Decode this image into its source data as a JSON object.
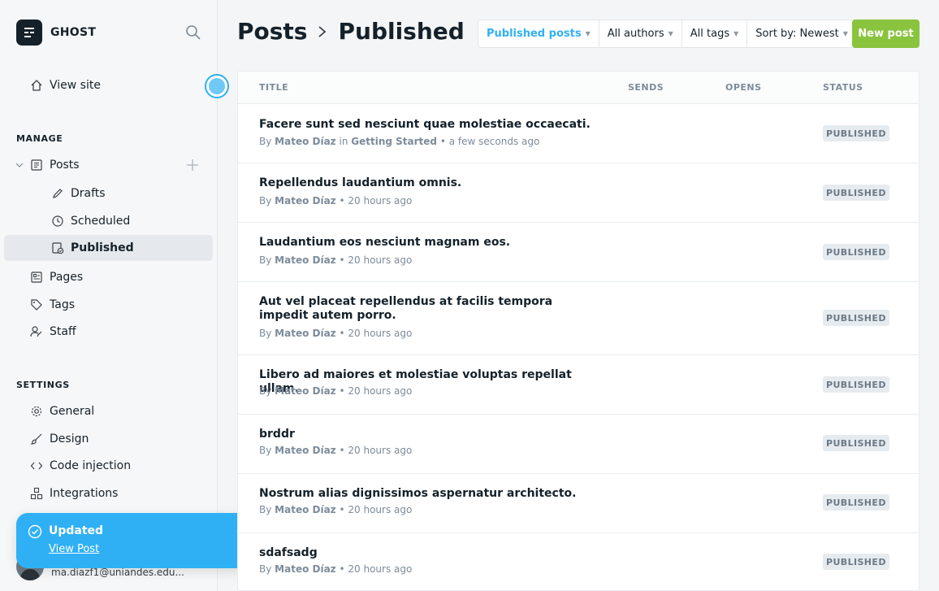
{
  "brand": {
    "name": "GHOST"
  },
  "sidebar": {
    "view_site": "View site",
    "manage_title": "MANAGE",
    "posts": "Posts",
    "drafts": "Drafts",
    "scheduled": "Scheduled",
    "published": "Published",
    "pages": "Pages",
    "tags": "Tags",
    "staff": "Staff",
    "settings_title": "SETTINGS",
    "general": "General",
    "design": "Design",
    "code_injection": "Code injection",
    "integrations": "Integrations"
  },
  "toast": {
    "title": "Updated",
    "link": "View Post"
  },
  "user": {
    "email": "ma.diazf1@uniandes.edu..."
  },
  "header": {
    "title": "Posts",
    "subtitle": "Published",
    "filters": {
      "type": "Published posts",
      "authors": "All authors",
      "tags": "All tags",
      "sort": "Sort by: Newest"
    },
    "new_post": "New post"
  },
  "table": {
    "columns": {
      "title": "TITLE",
      "sends": "SENDS",
      "opens": "OPENS",
      "status": "STATUS"
    },
    "rows": [
      {
        "title": "Facere sunt sed nesciunt quae molestiae occaecati.",
        "by": "By",
        "author": "Mateo Díaz",
        "in": "in",
        "tag": "Getting Started",
        "time": "• a few seconds ago",
        "status": "PUBLISHED"
      },
      {
        "title": "Repellendus laudantium omnis.",
        "by": "By",
        "author": "Mateo Díaz",
        "time": "• 20 hours ago",
        "status": "PUBLISHED"
      },
      {
        "title": "Laudantium eos nesciunt magnam eos.",
        "by": "By",
        "author": "Mateo Díaz",
        "time": "• 20 hours ago",
        "status": "PUBLISHED"
      },
      {
        "title": "Aut vel placeat repellendus at facilis tempora impedit autem porro.",
        "by": "By",
        "author": "Mateo Díaz",
        "time": "• 20 hours ago",
        "status": "PUBLISHED"
      },
      {
        "title": "Libero ad maiores et molestiae voluptas repellat ullam.",
        "by": "By",
        "author": "Mateo Díaz",
        "time": "• 20 hours ago",
        "status": "PUBLISHED"
      },
      {
        "title": "brddr",
        "by": "By",
        "author": "Mateo Díaz",
        "time": "• 20 hours ago",
        "status": "PUBLISHED"
      },
      {
        "title": "Nostrum alias dignissimos aspernatur architecto.",
        "by": "By",
        "author": "Mateo Díaz",
        "time": "• 20 hours ago",
        "status": "PUBLISHED"
      },
      {
        "title": "sdafsadg",
        "by": "By",
        "author": "Mateo Díaz",
        "time": "• 20 hours ago",
        "status": "PUBLISHED"
      }
    ]
  },
  "colors": {
    "accent": "#30b0f4",
    "new_post": "#8ac43f",
    "sidebar_active": "#e5e9ed"
  }
}
